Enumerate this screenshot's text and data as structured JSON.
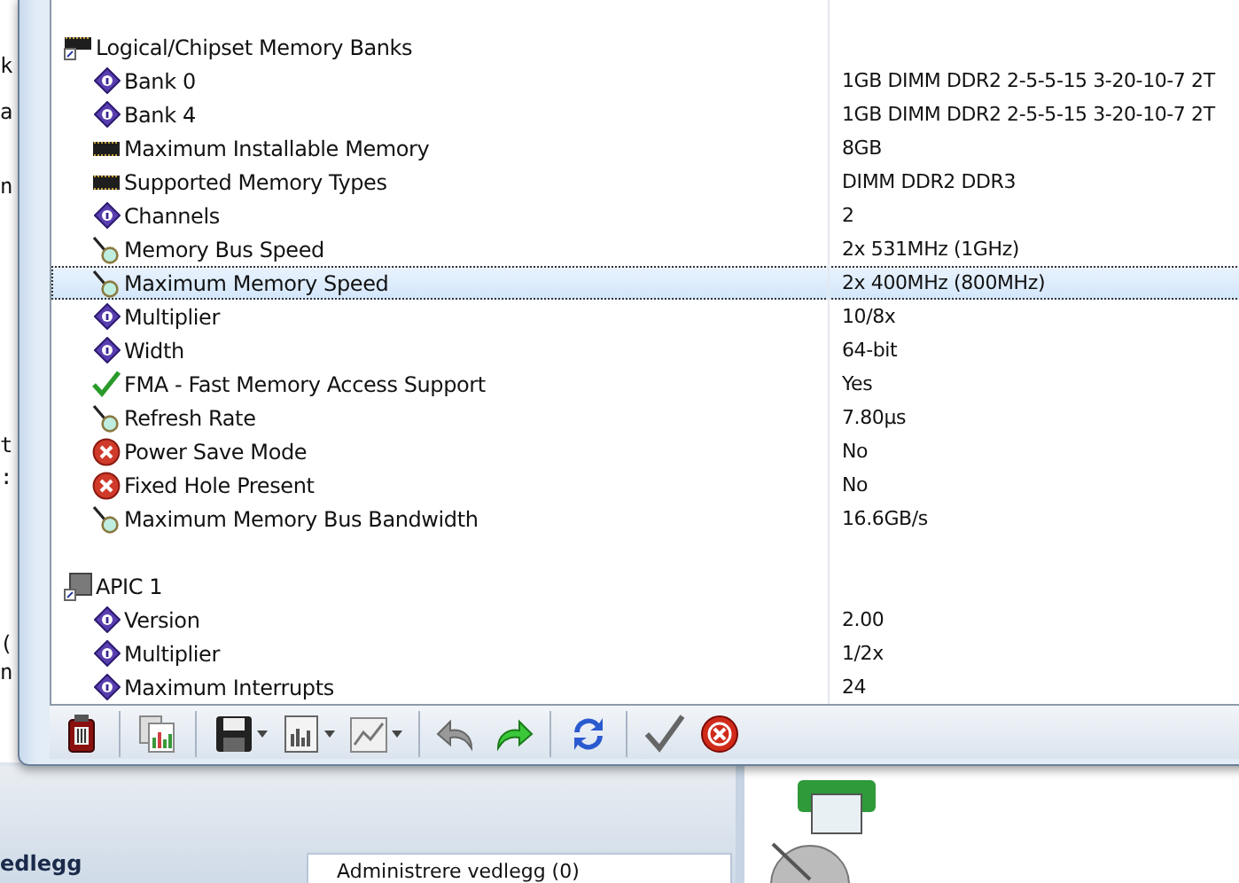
{
  "background_window": {
    "fragments": [
      "k",
      "a",
      "n",
      "t",
      ":",
      "(",
      "n"
    ],
    "section_label": "edlegg",
    "tab": "Administrere vedlegg (0)"
  },
  "tree": {
    "children": [
      {
        "label": "Logical/Chipset Memory Banks",
        "kind": "chips",
        "children": [
          {
            "label": "Bank 0",
            "kind": "diamond",
            "value": "1GB DIMM DDR2 2-5-5-15 3-20-10-7 2T",
            "selected": false
          },
          {
            "label": "Bank 4",
            "kind": "diamond",
            "value": "1GB DIMM DDR2 2-5-5-15 3-20-10-7 2T",
            "selected": false
          },
          {
            "label": "Maximum Installable Memory",
            "kind": "chip",
            "value": "8GB",
            "selected": false
          },
          {
            "label": "Supported Memory Types",
            "kind": "chip",
            "value": "DIMM DDR2 DDR3",
            "selected": false
          },
          {
            "label": "Channels",
            "kind": "diamond",
            "value": "2",
            "selected": false
          },
          {
            "label": "Memory Bus Speed",
            "kind": "probe",
            "value": "2x 531MHz (1GHz)",
            "selected": false
          },
          {
            "label": "Maximum Memory Speed",
            "kind": "probe",
            "value": "2x 400MHz (800MHz)",
            "selected": true
          },
          {
            "label": "Multiplier",
            "kind": "diamond",
            "value": "10/8x",
            "selected": false
          },
          {
            "label": "Width",
            "kind": "diamond",
            "value": "64-bit",
            "selected": false
          },
          {
            "label": "FMA - Fast Memory Access Support",
            "kind": "check",
            "value": "Yes",
            "selected": false
          },
          {
            "label": "Refresh Rate",
            "kind": "probe",
            "value": "7.80µs",
            "selected": false
          },
          {
            "label": "Power Save Mode",
            "kind": "cross",
            "value": "No",
            "selected": false
          },
          {
            "label": "Fixed Hole Present",
            "kind": "cross",
            "value": "No",
            "selected": false
          },
          {
            "label": "Maximum Memory Bus Bandwidth",
            "kind": "probe",
            "value": "16.6GB/s",
            "selected": false
          }
        ]
      },
      {
        "label": "APIC 1",
        "kind": "apic",
        "children": [
          {
            "label": "Version",
            "kind": "diamond",
            "value": "2.00",
            "selected": false
          },
          {
            "label": "Multiplier",
            "kind": "diamond",
            "value": "1/2x",
            "selected": false
          },
          {
            "label": "Maximum Interrupts",
            "kind": "diamond",
            "value": "24",
            "selected": false
          }
        ]
      }
    ]
  },
  "toolbar": [
    {
      "kind": "device",
      "dropdown": false
    },
    {
      "kind": "separator"
    },
    {
      "kind": "report",
      "dropdown": false
    },
    {
      "kind": "separator"
    },
    {
      "kind": "save",
      "dropdown": true
    },
    {
      "kind": "document",
      "dropdown": true
    },
    {
      "kind": "graph",
      "dropdown": true
    },
    {
      "kind": "separator"
    },
    {
      "kind": "undo",
      "dropdown": false
    },
    {
      "kind": "redo",
      "dropdown": false
    },
    {
      "kind": "separator"
    },
    {
      "kind": "refresh",
      "dropdown": false
    },
    {
      "kind": "separator"
    },
    {
      "kind": "ok",
      "dropdown": false
    },
    {
      "kind": "cancel",
      "dropdown": false
    }
  ]
}
